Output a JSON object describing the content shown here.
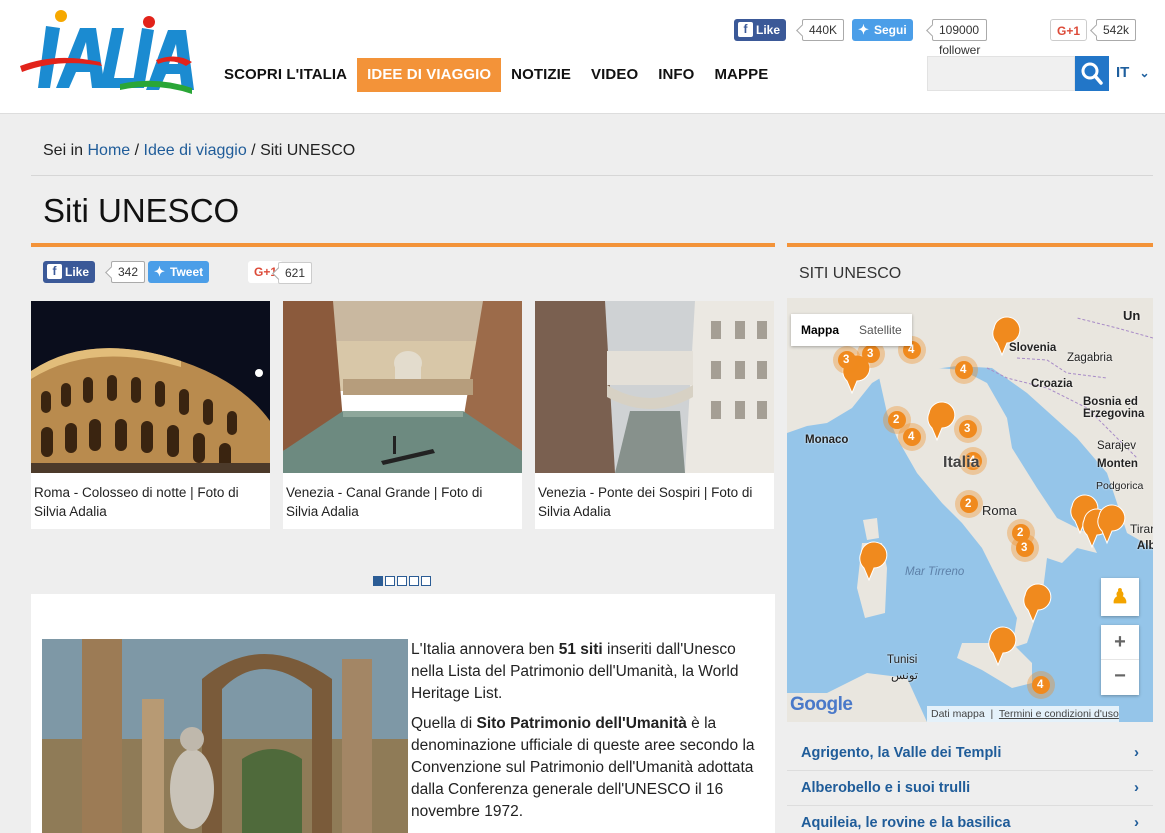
{
  "header": {
    "logo_text": "ITALIA",
    "nav": [
      {
        "label": "SCOPRI L'ITALIA",
        "active": false
      },
      {
        "label": "IDEE DI VIAGGIO",
        "active": true
      },
      {
        "label": "NOTIZIE",
        "active": false
      },
      {
        "label": "VIDEO",
        "active": false
      },
      {
        "label": "INFO",
        "active": false
      },
      {
        "label": "MAPPE",
        "active": false
      }
    ],
    "social": {
      "fb_label": "Like",
      "fb_count": "440K",
      "tw_label": "Segui",
      "tw_count": "109000 follower",
      "gp_label": "G+1",
      "gp_count": "542k"
    },
    "search_placeholder": "",
    "language": "IT"
  },
  "breadcrumb": {
    "prefix": "Sei in",
    "home": "Home",
    "sep": "/",
    "parent": "Idee di viaggio",
    "current": "Siti UNESCO"
  },
  "page_title": "Siti UNESCO",
  "page_share": {
    "fb_label": "Like",
    "fb_count": "342",
    "tw_label": "Tweet",
    "gp_label": "G+1",
    "gp_count": "621"
  },
  "gallery": {
    "slides": [
      {
        "caption": "Roma - Colosseo di notte | Foto di Silvia Adalia"
      },
      {
        "caption": "Venezia - Canal Grande | Foto di Silvia Adalia"
      },
      {
        "caption": "Venezia - Ponte dei Sospiri | Foto di Silvia Adalia"
      }
    ],
    "pages": 5,
    "current_page": 1
  },
  "article": {
    "p1_before": "L'Italia annovera ben ",
    "p1_bold": "51 siti",
    "p1_after": " inseriti dall'Unesco nella Lista del Patrimonio dell'Umanità, la World Heritage List.",
    "p2_before": "Quella di ",
    "p2_bold": "Sito Patrimonio dell'Umanità",
    "p2_after": " è la denominazione ufficiale di queste aree secondo la Convenzione sul Patrimonio dell'Umanità adottata dalla Conferenza generale dell'UNESCO il 16 novembre 1972."
  },
  "sidebar": {
    "title": "SITI UNESCO",
    "map": {
      "tab_map": "Mappa",
      "tab_satellite": "Satellite",
      "zoom_in": "+",
      "zoom_out": "−",
      "footer_data": "Dati mappa",
      "footer_terms": "Termini e condizioni d'uso",
      "google": "Google",
      "labels": {
        "slovenia": "Slovenia",
        "zagabria": "Zagabria",
        "croazia": "Croazia",
        "bosnia1": "Bosnia ed",
        "bosnia2": "Erzegovina",
        "sarajevo": "Sarajev",
        "monten": "Monten",
        "podgorica": "Podgorica",
        "monaco": "Monaco",
        "italia": "Italia",
        "roma": "Roma",
        "tirana": "Tirar",
        "alb": "Alb",
        "mar_tirreno": "Mar Tirreno",
        "tunisi": "Tunisi",
        "tunisi_ar": "تونس",
        "un": "Un"
      },
      "clusters": [
        "3",
        "3",
        "4",
        "4",
        "2",
        "4",
        "3",
        "4",
        "2",
        "2",
        "3",
        "4"
      ]
    },
    "list": [
      "Agrigento, la Valle dei Templi",
      "Alberobello e i suoi trulli",
      "Aquileia, le rovine e la basilica"
    ]
  }
}
